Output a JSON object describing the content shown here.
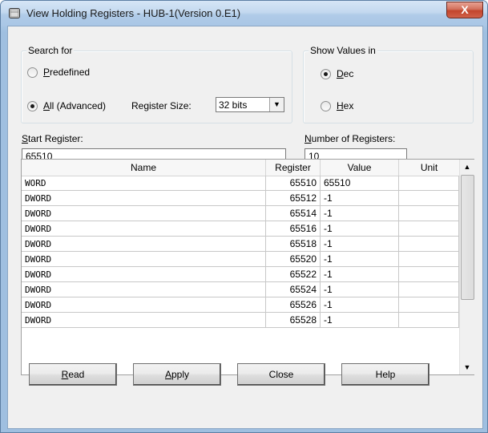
{
  "window": {
    "title": "View Holding Registers - HUB-1(Version 0.E1)",
    "close_glyph": "X"
  },
  "search_group": {
    "legend": "Search for",
    "options": [
      {
        "key": "P",
        "rest": "redefined",
        "selected": false
      },
      {
        "key": "A",
        "rest": "ll (Advanced)",
        "selected": true
      }
    ],
    "register_size_label": "Register Size:",
    "register_size_value": "32 bits"
  },
  "show_group": {
    "legend": "Show Values in",
    "options": [
      {
        "key": "D",
        "rest": "ec",
        "selected": true
      },
      {
        "key": "H",
        "rest": "ex",
        "selected": false
      }
    ]
  },
  "start_register": {
    "key": "S",
    "rest": "tart Register:",
    "value": "65510"
  },
  "number_of_registers": {
    "key": "N",
    "rest": "umber of Registers:",
    "value": "10"
  },
  "table": {
    "columns": [
      "Name",
      "Register",
      "Value",
      "Unit"
    ],
    "rows": [
      {
        "name": "WORD",
        "register": "65510",
        "value": "65510",
        "unit": ""
      },
      {
        "name": "DWORD",
        "register": "65512",
        "value": "-1",
        "unit": ""
      },
      {
        "name": "DWORD",
        "register": "65514",
        "value": "-1",
        "unit": ""
      },
      {
        "name": "DWORD",
        "register": "65516",
        "value": "-1",
        "unit": ""
      },
      {
        "name": "DWORD",
        "register": "65518",
        "value": "-1",
        "unit": ""
      },
      {
        "name": "DWORD",
        "register": "65520",
        "value": "-1",
        "unit": ""
      },
      {
        "name": "DWORD",
        "register": "65522",
        "value": "-1",
        "unit": ""
      },
      {
        "name": "DWORD",
        "register": "65524",
        "value": "-1",
        "unit": ""
      },
      {
        "name": "DWORD",
        "register": "65526",
        "value": "-1",
        "unit": ""
      },
      {
        "name": "DWORD",
        "register": "65528",
        "value": "-1",
        "unit": ""
      }
    ]
  },
  "buttons": {
    "read": {
      "key": "R",
      "rest": "ead"
    },
    "apply": {
      "key": "A",
      "rest": "pply"
    },
    "close": {
      "label": "Close"
    },
    "help": {
      "label": "Help"
    }
  },
  "icons": {
    "title": "register-window-icon",
    "scroll_up": "arrow-up-icon",
    "scroll_down": "arrow-down-icon",
    "combo": "dropdown-arrow-icon"
  }
}
